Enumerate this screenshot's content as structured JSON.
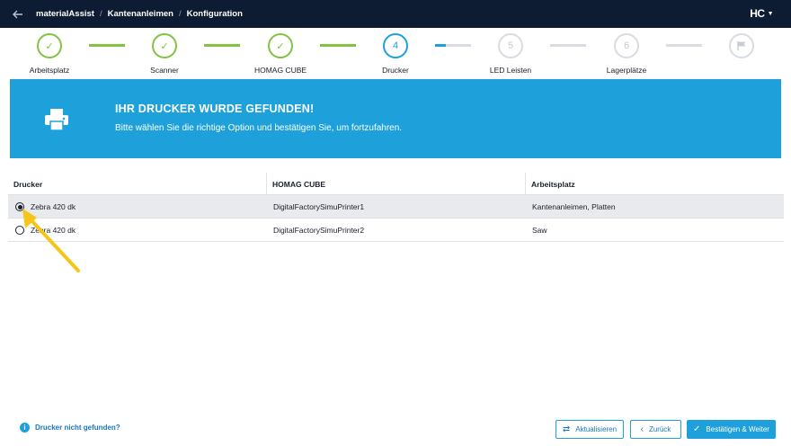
{
  "header": {
    "breadcrumbs": [
      "materialAssist",
      "Kantenanleimen",
      "Konfiguration"
    ],
    "separator": "/",
    "brand": "HC"
  },
  "stepper": {
    "steps": [
      {
        "label": "Arbeitsplatz",
        "state": "done",
        "marker": "✓"
      },
      {
        "label": "Scanner",
        "state": "done",
        "marker": "✓"
      },
      {
        "label": "HOMAG CUBE",
        "state": "done",
        "marker": "✓"
      },
      {
        "label": "Drucker",
        "state": "active",
        "marker": "4"
      },
      {
        "label": "LED Leisten",
        "state": "todo",
        "marker": "5"
      },
      {
        "label": "Lagerplätze",
        "state": "todo",
        "marker": "6"
      },
      {
        "label": "",
        "state": "todo",
        "marker": "flag-icon"
      }
    ]
  },
  "banner": {
    "title": "IHR DRUCKER WURDE GEFUNDEN!",
    "subtitle": "Bitte wählen Sie die richtige Option und bestätigen Sie, um fortzufahren.",
    "icon": "printer-icon"
  },
  "table": {
    "columns": [
      "Drucker",
      "HOMAG CUBE",
      "Arbeitsplatz"
    ],
    "rows": [
      {
        "printer": "Zebra 420 dk",
        "cube": "DigitalFactorySimuPrinter1",
        "workplace": "Kantenanleimen, Platten",
        "selected": true
      },
      {
        "printer": "Zebra 420 dk",
        "cube": "DigitalFactorySimuPrinter2",
        "workplace": "Saw",
        "selected": false
      }
    ]
  },
  "footer": {
    "help_link": "Drucker nicht gefunden?",
    "refresh_label": "Aktualisieren",
    "back_label": "Zurück",
    "confirm_label": "Bestätigen & Weiter"
  },
  "colors": {
    "header_bg": "#0d1b33",
    "accent": "#1ea0da",
    "done": "#82c341",
    "annotation_arrow": "#f5c518"
  }
}
